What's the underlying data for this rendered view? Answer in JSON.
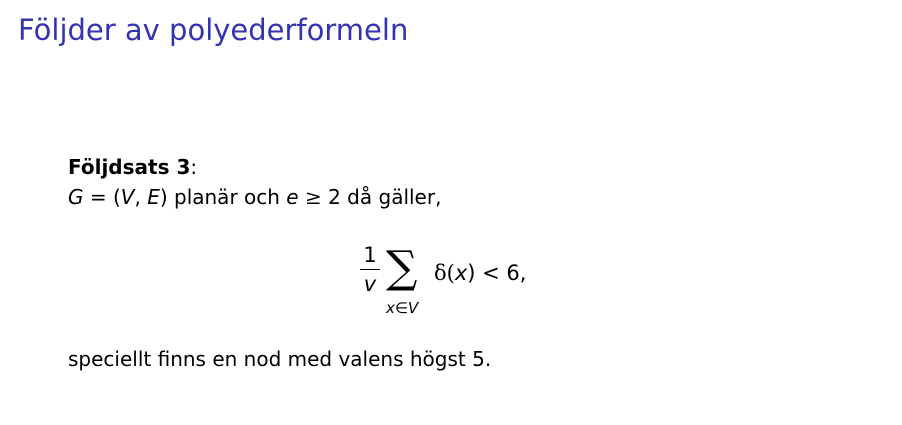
{
  "slide": {
    "title": "Följder av polyederformeln"
  },
  "theorem": {
    "label": "Följdsats 3",
    "label_colon": ":",
    "statement": {
      "G": "G",
      "eq": " = (",
      "V": "V",
      "comma": ", ",
      "E": "E",
      "close": ")",
      "text_plan": " planär och ",
      "e": "e",
      "geq": " ≥ ",
      "two": "2",
      "text_galler": " då gäller,"
    },
    "formula": {
      "numerator": "1",
      "denominator": "v",
      "sum_symbol": "∑",
      "sum_index": "x∈",
      "sum_set": "V",
      "delta": "δ(",
      "arg": "x",
      "close_lt": ") < 6,"
    },
    "conclusion": "speciellt finns en nod med valens högst 5."
  }
}
